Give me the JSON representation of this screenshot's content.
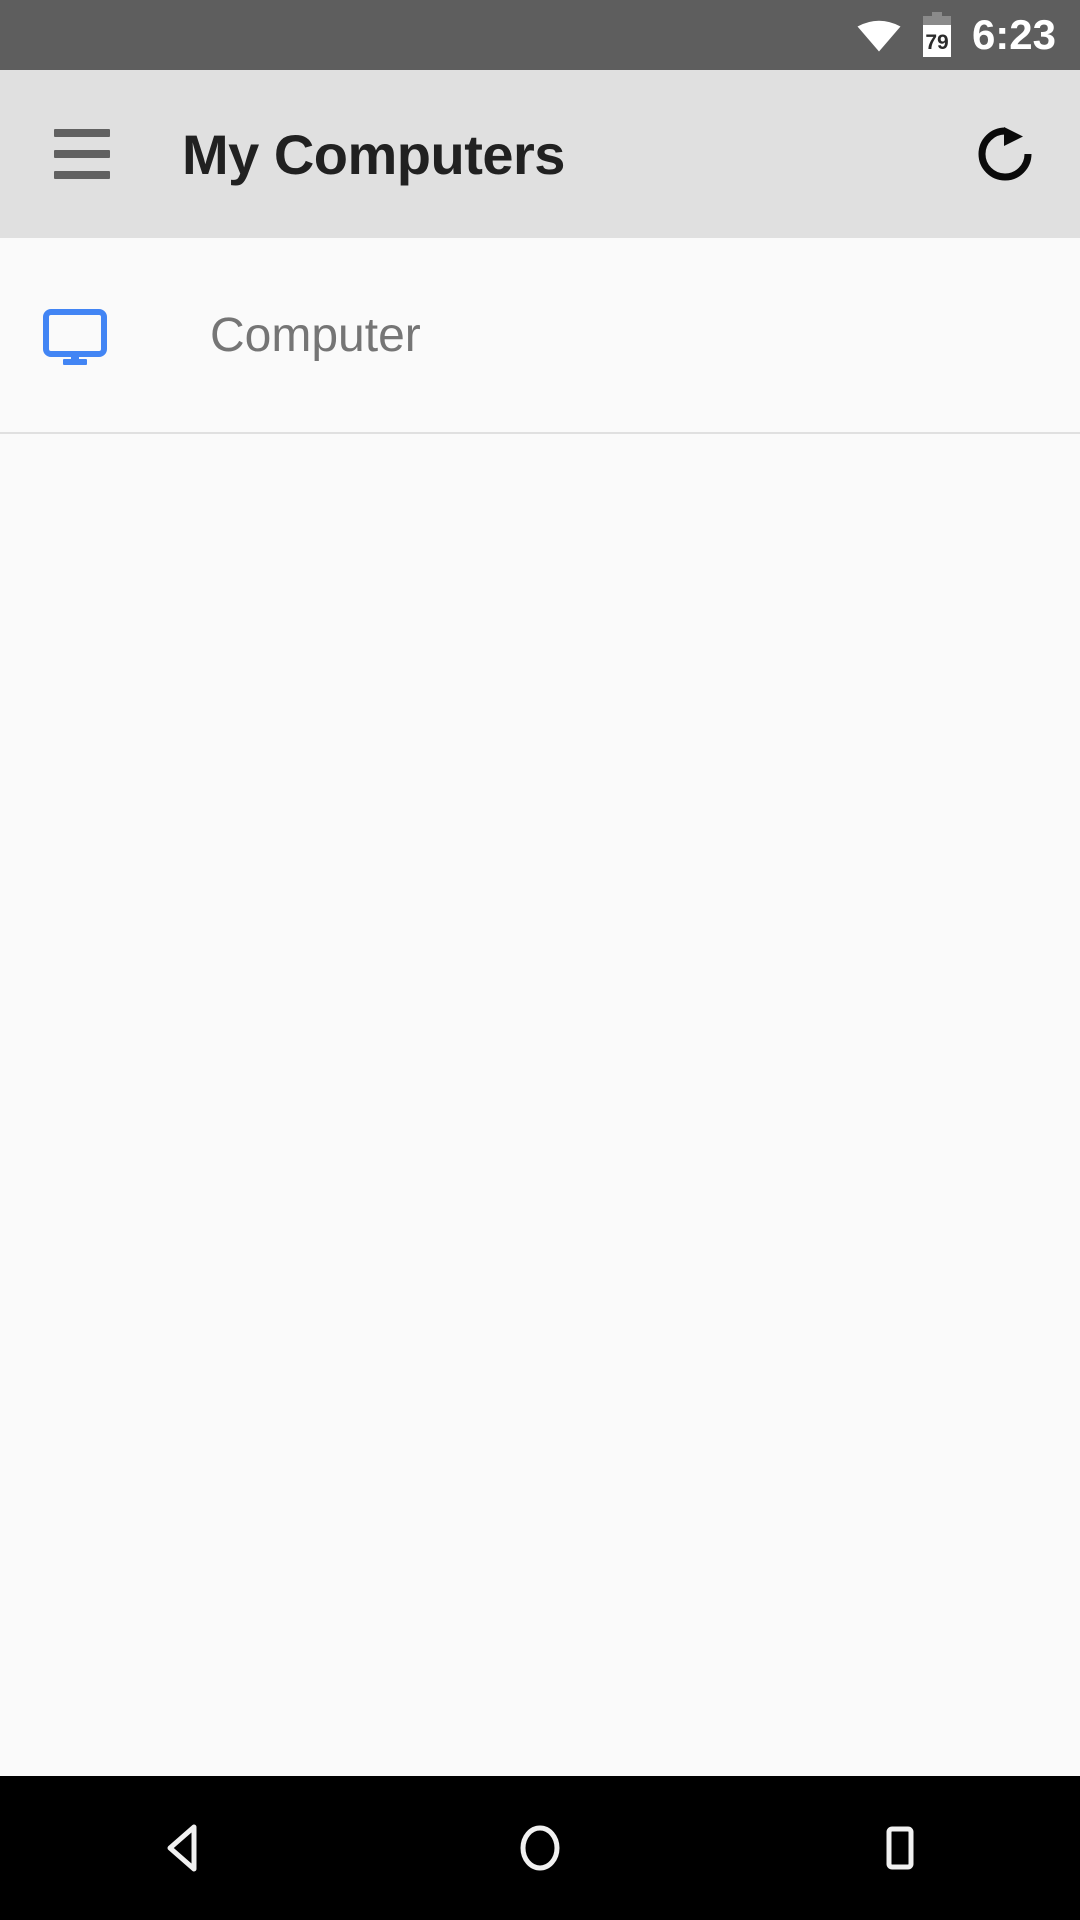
{
  "status_bar": {
    "wifi_icon": "wifi-full-icon",
    "battery_icon": "battery-icon",
    "battery_level": "79",
    "clock": "6:23",
    "background_color": "#5e5e5e",
    "foreground_color": "#ffffff"
  },
  "app_bar": {
    "menu_icon": "hamburger-menu-icon",
    "title": "My Computers",
    "refresh_icon": "refresh-icon",
    "background_color": "#e0e0e0",
    "title_color": "#212121"
  },
  "content": {
    "background_color": "#fafafa",
    "items": [
      {
        "icon": "desktop-monitor-icon",
        "icon_color": "#4285f4",
        "label": "Computer",
        "label_color": "#757575"
      }
    ]
  },
  "nav_bar": {
    "background_color": "#000000",
    "buttons": [
      {
        "name": "back",
        "icon": "back-triangle-icon"
      },
      {
        "name": "home",
        "icon": "home-circle-icon"
      },
      {
        "name": "recents",
        "icon": "recents-square-icon"
      }
    ]
  }
}
